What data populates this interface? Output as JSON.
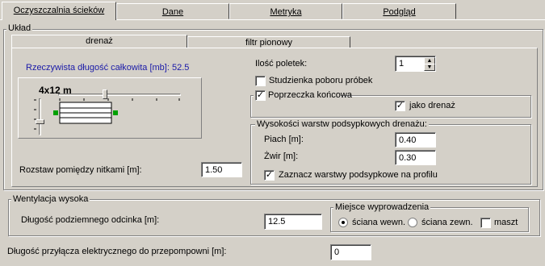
{
  "tabs": [
    {
      "label": "Oczyszczalnia ścieków",
      "active": true
    },
    {
      "label": "Dane",
      "active": false
    },
    {
      "label": "Metryka",
      "active": false
    },
    {
      "label": "Podgląd",
      "active": false
    }
  ],
  "uklad": {
    "title": "Układ",
    "subtabs": [
      {
        "label": "drenaż",
        "active": true
      },
      {
        "label": "filtr pionowy",
        "active": false
      }
    ],
    "total_length_label": "Rzeczywista długość całkowita [mb]: 52.5",
    "preview_size_label": "4x12 m",
    "rozstaw_label": "Rozstaw pomiędzy nitkami [m]:",
    "rozstaw_value": "1.50",
    "ilosc_label": "Ilość poletek:",
    "ilosc_value": "1",
    "studzienka_label": "Studzienka poboru próbek",
    "studzienka_checked": false,
    "poprzeczka_label": "Poprzeczka końcowa",
    "poprzeczka_checked": true,
    "jako_drenaz_label": "jako drenaż",
    "jako_drenaz_checked": true,
    "warstwy": {
      "title": "Wysokości warstw podsypkowych drenażu:",
      "piach_label": "Piach [m]:",
      "piach_value": "0.40",
      "zwir_label": "Żwir [m]:",
      "zwir_value": "0.30",
      "zaznacz_label": "Zaznacz warstwy podsypkowe na profilu",
      "zaznacz_checked": true
    }
  },
  "wentylacja": {
    "title": "Wentylacja wysoka",
    "dlugosc_label": "Długość podziemnego odcinka [m]:",
    "dlugosc_value": "12.5",
    "miejsce": {
      "title": "Miejsce wyprowadzenia",
      "opt1": "ściana wewn.",
      "opt2": "ściana zewn.",
      "opt3": "maszt",
      "selected": "ściana wewn."
    }
  },
  "przylacze_label": "Długość przyłącza elektrycznego do przepompowni [m]:",
  "przylacze_value": "0",
  "colors": {
    "blue_label": "#1a1aa8",
    "green_handle": "#00a000"
  }
}
